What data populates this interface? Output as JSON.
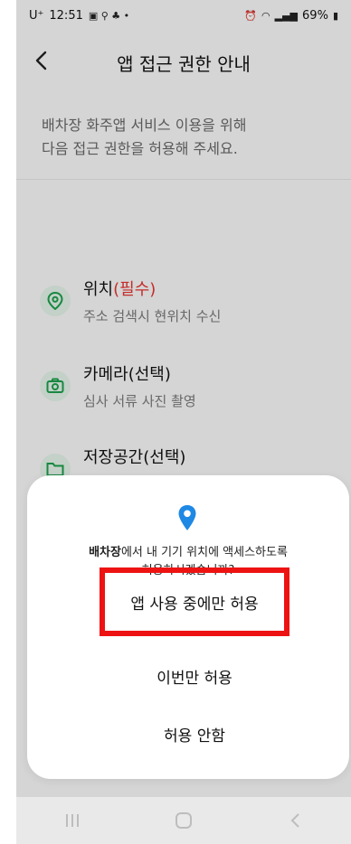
{
  "status_bar": {
    "carrier": "U⁺",
    "time": "12:51",
    "battery": "69%"
  },
  "header": {
    "title": "앱 접근 권한 안내",
    "back_icon": "chevron-left-icon"
  },
  "intro": {
    "line1": "배차장 화주앱 서비스 이용을 위해",
    "line2": "다음 접근 권한을 허용해 주세요."
  },
  "permissions": [
    {
      "title": "위치",
      "badge": "(필수)",
      "desc": "주소 검색시 현위치 수신",
      "icon": "location-icon"
    },
    {
      "title": "카메라",
      "badge": "(선택)",
      "desc": "심사 서류 사진 촬영",
      "icon": "camera-icon"
    },
    {
      "title": "저장공간",
      "badge": "(선택)",
      "desc": "",
      "icon": "folder-icon"
    }
  ],
  "dialog": {
    "app_name": "배차장",
    "message_rest_line1": "에서 내 기기 위치에 액세스하도록",
    "message_line2": "허용하시겠습니까?",
    "btn_while_using": "앱 사용 중에만 허용",
    "btn_only_once": "이번만 허용",
    "btn_deny": "허용 안함"
  },
  "colors": {
    "accent_green": "#1c9b4a",
    "required_red": "#e0332f",
    "highlight_red": "#ee1313",
    "pin_blue": "#1e88e5"
  }
}
